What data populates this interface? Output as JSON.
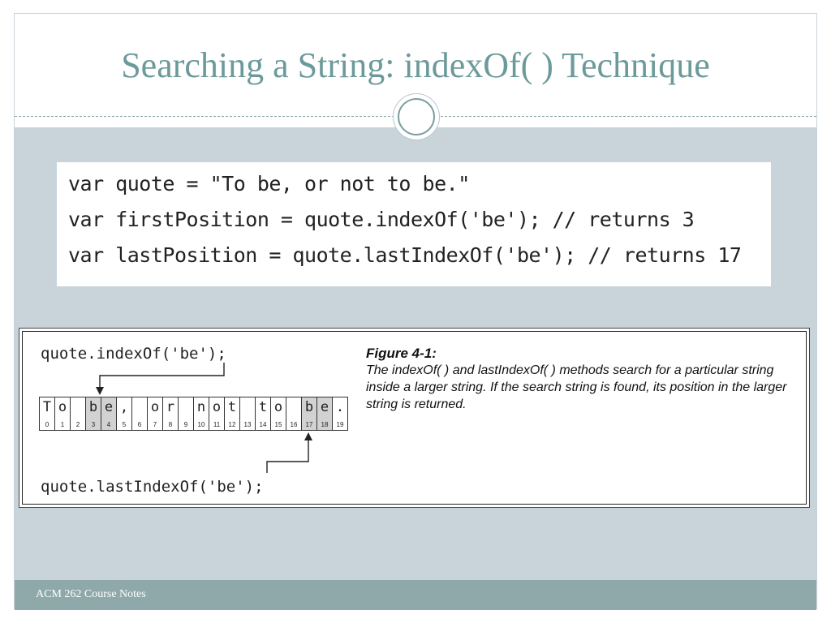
{
  "slide": {
    "title": "Searching a String: indexOf( ) Technique",
    "footer": "ACM 262 Course Notes"
  },
  "code": {
    "lines": [
      "var quote = \"To be, or not to be.\"",
      "var firstPosition = quote.indexOf('be'); // returns 3",
      "var lastPosition = quote.lastIndexOf('be'); // returns 17"
    ]
  },
  "figure": {
    "call_top": "quote.indexOf('be');",
    "call_bottom": "quote.lastIndexOf('be');",
    "heading": "Figure 4-1:",
    "caption": "The indexOf( ) and lastIndexOf( ) methods search for a particular string inside a larger string. If the search string is found, its position in the larger string is returned.",
    "cells": [
      {
        "ch": "T",
        "idx": "0"
      },
      {
        "ch": "o",
        "idx": "1"
      },
      {
        "ch": "",
        "idx": "2"
      },
      {
        "ch": "b",
        "idx": "3"
      },
      {
        "ch": "e",
        "idx": "4"
      },
      {
        "ch": ",",
        "idx": "5"
      },
      {
        "ch": "",
        "idx": "6"
      },
      {
        "ch": "o",
        "idx": "7"
      },
      {
        "ch": "r",
        "idx": "8"
      },
      {
        "ch": "",
        "idx": "9"
      },
      {
        "ch": "n",
        "idx": "10"
      },
      {
        "ch": "o",
        "idx": "11"
      },
      {
        "ch": "t",
        "idx": "12"
      },
      {
        "ch": "",
        "idx": "13"
      },
      {
        "ch": "t",
        "idx": "14"
      },
      {
        "ch": "o",
        "idx": "15"
      },
      {
        "ch": "",
        "idx": "16"
      },
      {
        "ch": "b",
        "idx": "17"
      },
      {
        "ch": "e",
        "idx": "18"
      },
      {
        "ch": ".",
        "idx": "19"
      }
    ],
    "highlighted_indices": [
      3,
      4,
      17,
      18
    ]
  },
  "colors": {
    "title": "#6c9a9a",
    "content_bg": "#c9d4da",
    "footer_bg": "#8fa9ab",
    "highlight_cell": "#d2d2d2"
  }
}
